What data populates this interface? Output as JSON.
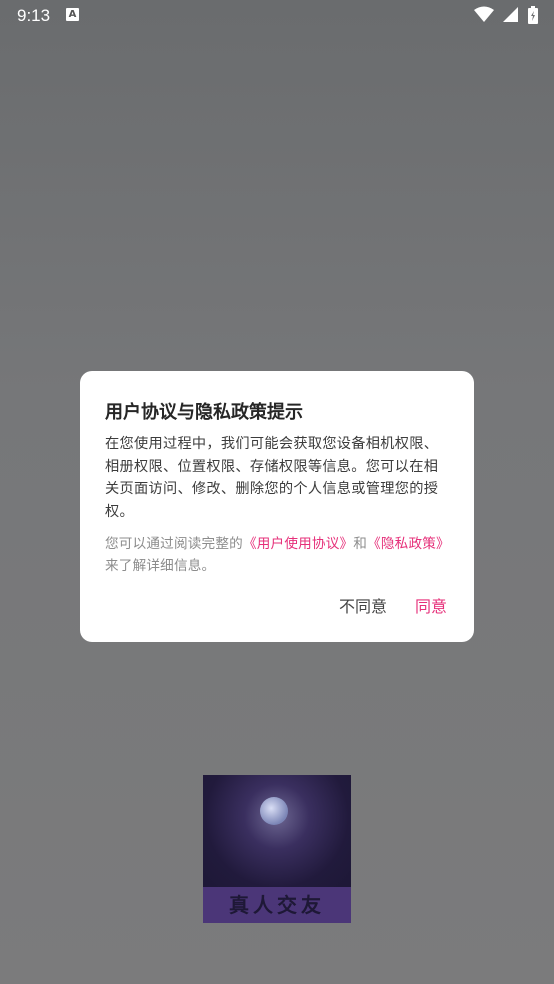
{
  "status": {
    "time": "9:13",
    "notif_icon": "A"
  },
  "dialog": {
    "title": "用户协议与隐私政策提示",
    "body": "在您使用过程中，我们可能会获取您设备相机权限、相册权限、位置权限、存储权限等信息。您可以在相关页面访问、修改、删除您的个人信息或管理您的授权。",
    "note_prefix": "您可以通过阅读完整的",
    "user_agreement_link": "《用户使用协议》",
    "note_and": "和",
    "privacy_link": "《隐私政策》",
    "note_suffix": "来了解详细信息。",
    "disagree_label": "不同意",
    "agree_label": "同意"
  },
  "splash": {
    "logo_text": "真人交友"
  },
  "colors": {
    "accent": "#e6307a",
    "overlay": "#777778"
  }
}
